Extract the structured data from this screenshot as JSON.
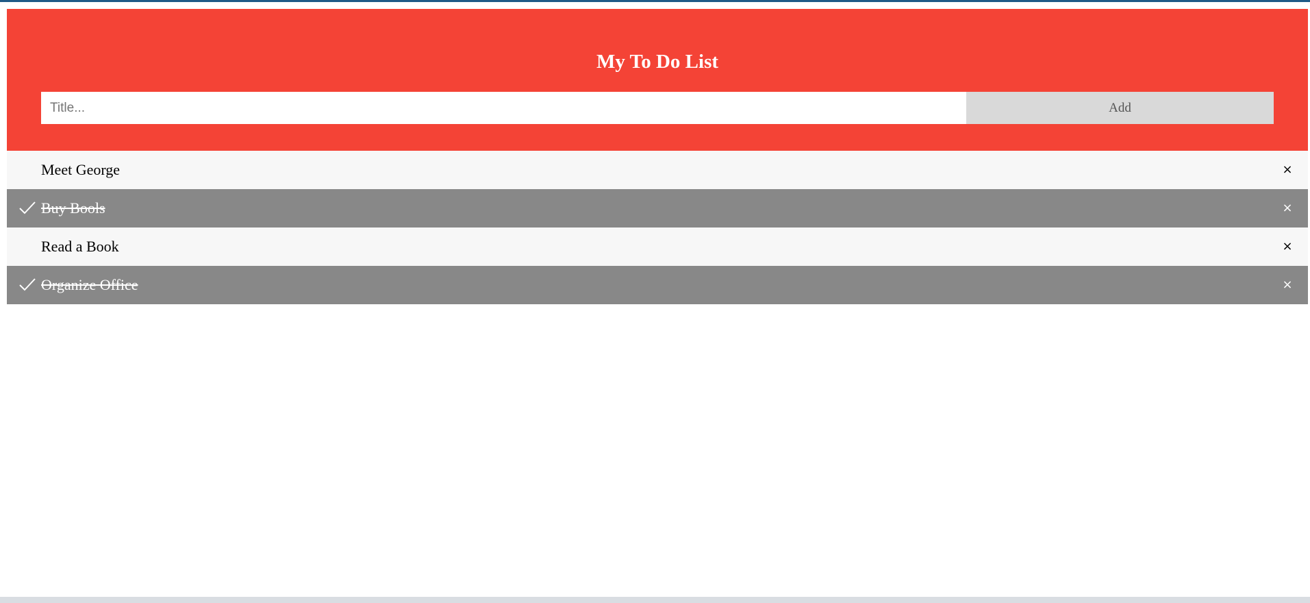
{
  "app": {
    "title": "My To Do List"
  },
  "form": {
    "input_placeholder": "Title...",
    "input_value": "",
    "add_label": "Add"
  },
  "todos": [
    {
      "label": "Meet George",
      "checked": false,
      "close_glyph": "×"
    },
    {
      "label": "Buy Bools",
      "checked": true,
      "close_glyph": "×"
    },
    {
      "label": "Read a Book",
      "checked": false,
      "close_glyph": "×"
    },
    {
      "label": "Organize Office",
      "checked": true,
      "close_glyph": "×"
    }
  ],
  "colors": {
    "header_bg": "#f44336",
    "checked_bg": "#888888",
    "unchecked_bg": "#f7f7f7",
    "add_button_bg": "#d9d9d9"
  },
  "icons": {
    "check": "check-icon",
    "close": "close-icon"
  }
}
